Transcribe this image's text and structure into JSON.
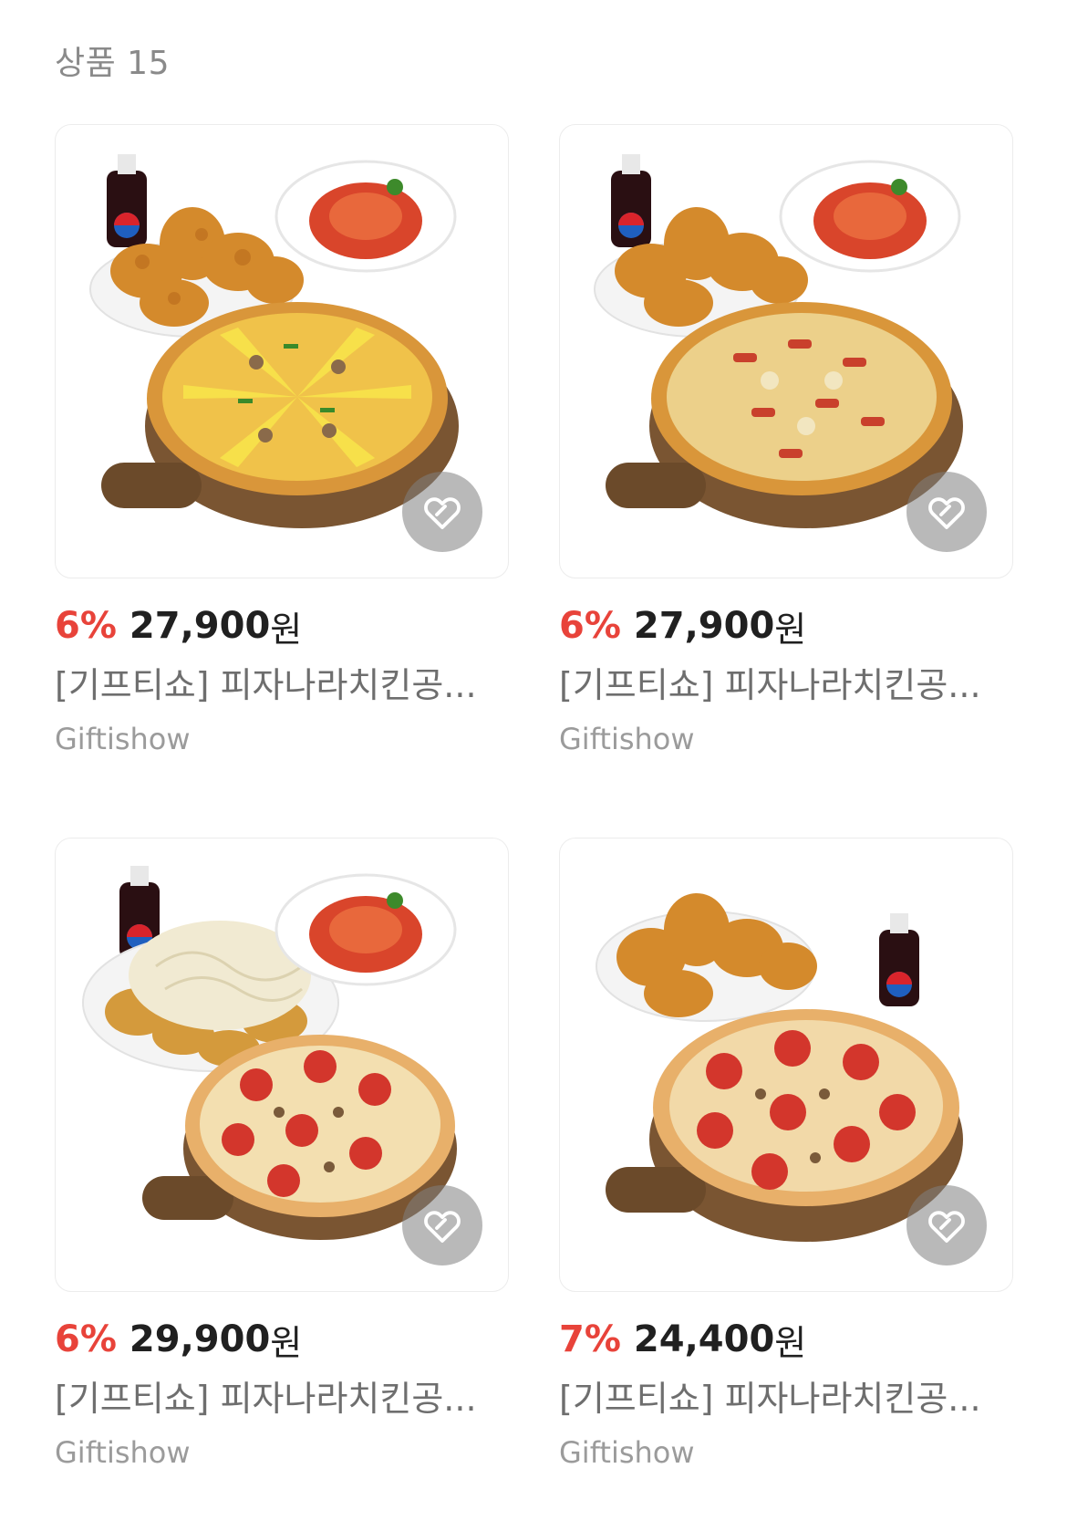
{
  "header": {
    "count_label": "상품 15"
  },
  "colors": {
    "discount": "#e8433a",
    "price": "#202020",
    "muted": "#9b9b9b"
  },
  "products": [
    {
      "discount": "6%",
      "price": "27,900",
      "currency": "원",
      "title": "[기프티쇼] 피자나라치킨공...",
      "brand": "Giftishow",
      "image": "pizza-chicken-pasta-set-potato-pizza",
      "like_icon": "heart-outline-icon"
    },
    {
      "discount": "6%",
      "price": "27,900",
      "currency": "원",
      "title": "[기프티쇼] 피자나라치킨공...",
      "brand": "Giftishow",
      "image": "pizza-chicken-pasta-set-sausage-pizza",
      "like_icon": "heart-outline-icon"
    },
    {
      "discount": "6%",
      "price": "29,900",
      "currency": "원",
      "title": "[기프티쇼] 피자나라치킨공...",
      "brand": "Giftishow",
      "image": "pizza-snowing-chicken-pasta-set",
      "like_icon": "heart-outline-icon"
    },
    {
      "discount": "7%",
      "price": "24,400",
      "currency": "원",
      "title": "[기프티쇼] 피자나라치킨공...",
      "brand": "Giftishow",
      "image": "pepperoni-pizza-chicken-cola-set",
      "like_icon": "heart-outline-icon"
    }
  ]
}
